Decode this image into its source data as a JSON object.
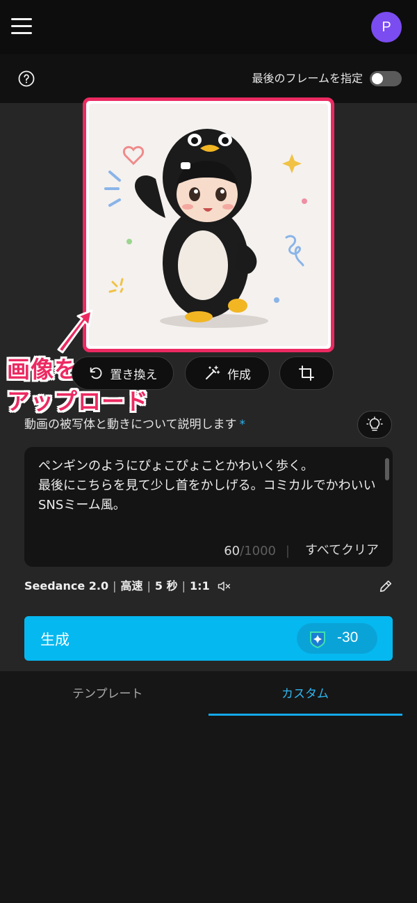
{
  "header": {
    "avatar_initial": "P"
  },
  "settings": {
    "last_frame_label": "最後のフレームを指定",
    "last_frame_enabled": false
  },
  "actions": {
    "replace_label": "置き換え",
    "create_label": "作成"
  },
  "annotation": {
    "line1": "画像を",
    "line2": "アップロード",
    "color": "#ec2a62"
  },
  "prompt": {
    "label": "動画の被写体と動きについて説明します",
    "required_mark": "*",
    "text": "ペンギンのようにぴょこぴょことかわいく歩く。\n最後にこちらを見て少し首をかしげる。コミカルでかわいいSNSミーム風。",
    "count": "60",
    "max": "/1000",
    "separator": "|",
    "clear_label": "すべてクリア"
  },
  "summary": {
    "model": "Seedance 2.0",
    "speed": "高速",
    "duration": "5 秒",
    "ratio": "1:1",
    "sep": "|"
  },
  "generate": {
    "label": "生成",
    "credits": "-30",
    "color": "#06b8f0"
  },
  "tabs": {
    "templates": "テンプレート",
    "custom": "カスタム",
    "active": "custom"
  }
}
